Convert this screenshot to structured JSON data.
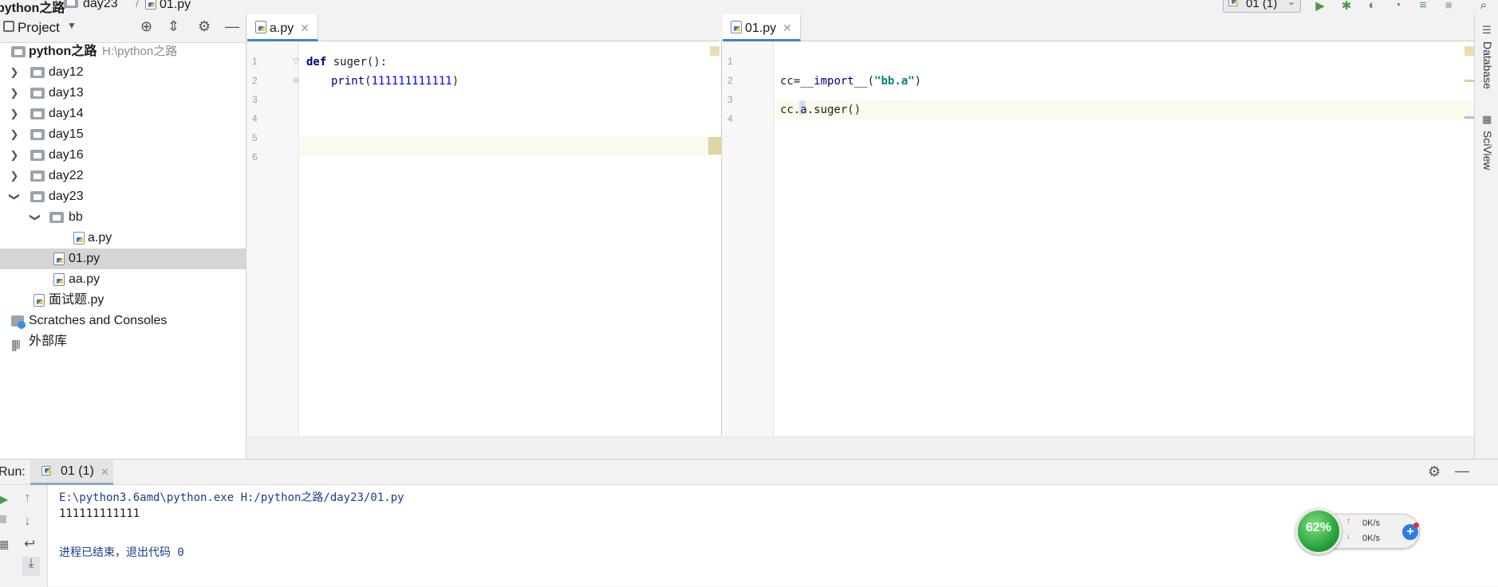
{
  "breadcrumb": {
    "project": "python之路",
    "folder": "day23",
    "file": "01.py"
  },
  "toolbar": {
    "run_config": "01 (1)"
  },
  "project_panel": {
    "title": "Project",
    "root_name": "python之路",
    "root_path": "H:\\python之路",
    "items": [
      {
        "label": "day12"
      },
      {
        "label": "day13"
      },
      {
        "label": "day14"
      },
      {
        "label": "day15"
      },
      {
        "label": "day16"
      },
      {
        "label": "day22"
      },
      {
        "label": "day23"
      },
      {
        "label": "bb"
      },
      {
        "label": "a.py"
      },
      {
        "label": "01.py"
      },
      {
        "label": "aa.py"
      },
      {
        "label": "面试题.py"
      },
      {
        "label": "Scratches and Consoles"
      },
      {
        "label": "外部库"
      }
    ]
  },
  "editor_left": {
    "tab": "a.py",
    "line_numbers": [
      "1",
      "2",
      "3",
      "4",
      "5",
      "6"
    ],
    "code": {
      "l1_kw": "def",
      "l1_rest": " suger():",
      "l2_fn": "print",
      "l2_open": "(",
      "l2_num": "111111111111",
      "l2_close": ")"
    }
  },
  "editor_right": {
    "tab": "01.py",
    "line_numbers": [
      "1",
      "2",
      "3",
      "4"
    ],
    "code": {
      "l2_a": "cc=",
      "l2_b": "__import__",
      "l2_c": "(",
      "l2_str": "\"bb.a\"",
      "l2_d": ")",
      "l4": "cc.a.suger()"
    }
  },
  "right_strip": {
    "database": "Database",
    "sciview": "SciView"
  },
  "run_panel": {
    "label": "Run:",
    "tab": "01 (1)",
    "output": [
      "E:\\python3.6amd\\python.exe H:/python之路/day23/01.py",
      "111111111111",
      "",
      "进程已结束，退出代码 0"
    ]
  },
  "net_widget": {
    "cpu_percent": "62%",
    "up": "0K/s",
    "down": "0K/s"
  }
}
